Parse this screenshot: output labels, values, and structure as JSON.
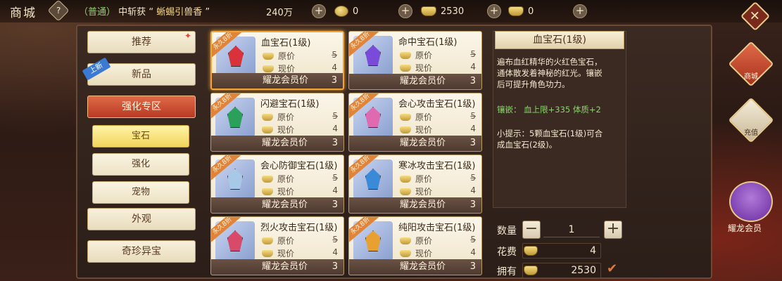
{
  "top": {
    "title": "商城",
    "help": "?",
    "marquee": {
      "channel": "（普通）",
      "text1": "中斩获",
      "quote_open": "“",
      "item": "蜥蜴引兽香",
      "quote_close": "”"
    },
    "resources": [
      {
        "value": "240万",
        "icon": "coin-icon"
      },
      {
        "value": "0",
        "icon": "coin-icon"
      },
      {
        "value": "2530",
        "icon": "ingot-icon"
      },
      {
        "value": "0",
        "icon": "ingot-icon"
      }
    ],
    "plus": "+",
    "close": "✕"
  },
  "sidebar": {
    "categories": [
      "推荐",
      "新品",
      "强化专区",
      "外观",
      "奇珍异宝"
    ],
    "new_tag": "上新",
    "subcategories": [
      "宝石",
      "强化",
      "宠物"
    ]
  },
  "products": [
    {
      "name": "血宝石(1级)",
      "tag": "永久8折",
      "orig_label": "原价",
      "orig": "5",
      "cur_label": "现价",
      "cur": "4",
      "vip_label": "耀龙会员价",
      "vip": "3",
      "gem_color": "#d8323a"
    },
    {
      "name": "命中宝石(1级)",
      "tag": "永久8折",
      "orig_label": "原价",
      "orig": "5",
      "cur_label": "现价",
      "cur": "4",
      "vip_label": "耀龙会员价",
      "vip": "3",
      "gem_color": "#7a4ad8"
    },
    {
      "name": "闪避宝石(1级)",
      "tag": "永久8折",
      "orig_label": "原价",
      "orig": "5",
      "cur_label": "现价",
      "cur": "4",
      "vip_label": "耀龙会员价",
      "vip": "3",
      "gem_color": "#2aa05a"
    },
    {
      "name": "会心攻击宝石(1级)",
      "tag": "永久8折",
      "orig_label": "原价",
      "orig": "5",
      "cur_label": "现价",
      "cur": "4",
      "vip_label": "耀龙会员价",
      "vip": "3",
      "gem_color": "#e06ab0"
    },
    {
      "name": "会心防御宝石(1级)",
      "tag": "永久8折",
      "orig_label": "原价",
      "orig": "5",
      "cur_label": "现价",
      "cur": "4",
      "vip_label": "耀龙会员价",
      "vip": "3",
      "gem_color": "#a8c8e8"
    },
    {
      "name": "寒冰攻击宝石(1级)",
      "tag": "永久8折",
      "orig_label": "原价",
      "orig": "5",
      "cur_label": "现价",
      "cur": "4",
      "vip_label": "耀龙会员价",
      "vip": "3",
      "gem_color": "#3a8ad8"
    },
    {
      "name": "烈火攻击宝石(1级)",
      "tag": "永久8折",
      "orig_label": "原价",
      "orig": "5",
      "cur_label": "现价",
      "cur": "4",
      "vip_label": "耀龙会员价",
      "vip": "3",
      "gem_color": "#d84a6a"
    },
    {
      "name": "纯阳攻击宝石(1级)",
      "tag": "永久8折",
      "orig_label": "原价",
      "orig": "5",
      "cur_label": "现价",
      "cur": "4",
      "vip_label": "耀龙会员价",
      "vip": "3",
      "gem_color": "#e8a030"
    }
  ],
  "detail": {
    "title": "血宝石(1级)",
    "desc1": "遍布血红精华的火红色宝石，",
    "desc2": "通体散发着神秘的红光。镶嵌",
    "desc3": "后可提升角色功力。",
    "inlay": "镶嵌：  血上限+335   体质+2",
    "tip1": "小提示：5颗血宝石(1级)可合",
    "tip2": "成血宝石(2级)。"
  },
  "buy": {
    "qty_label": "数量",
    "qty": "1",
    "minus": "−",
    "plus": "+",
    "cost_label": "花费",
    "cost": "4",
    "own_label": "拥有",
    "own": "2530",
    "check": "✔"
  },
  "side": {
    "shop": "商城",
    "recharge": "充值",
    "vip": "耀龙会员"
  }
}
